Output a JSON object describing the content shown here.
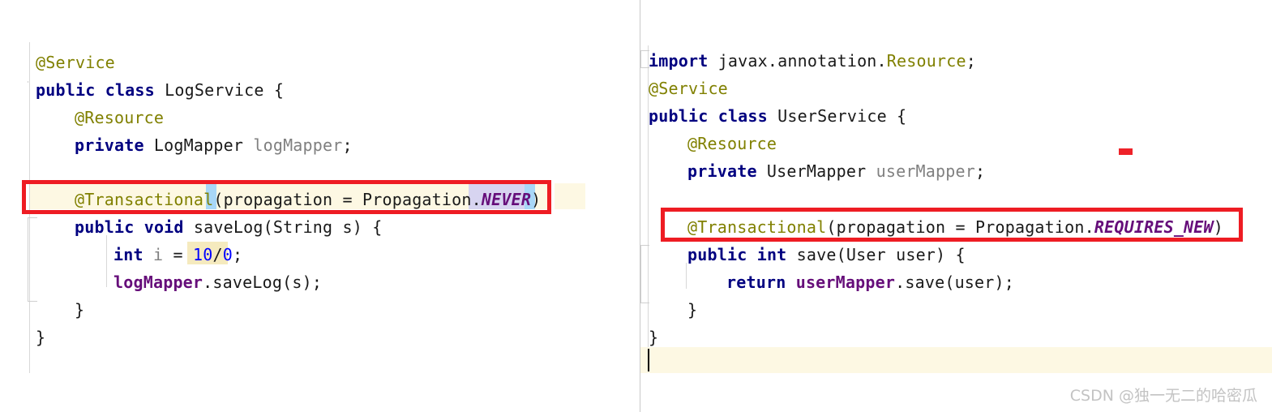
{
  "editor": {
    "theme": "IntelliJ Light",
    "split_panes": 2,
    "colors": {
      "keyword": "#000080",
      "annotation": "#808000",
      "field": "#660e7a",
      "local_var": "#808080",
      "number": "#0000ff",
      "enum_constant": "#660e7a",
      "plain_text": "#1a1a1a",
      "caret_row_bg": "#fdf8e3",
      "error_highlight_bg": "#f5eabe",
      "brace_match_bg": "#a8d7f7",
      "selection_bg": "#d7d4f0",
      "annotation_box": "#ee1c23",
      "error_stripe": "#ee2229",
      "splitter": "#c9c9c9",
      "indent_guide": "#d8d8d8"
    }
  },
  "left_pane": {
    "file_class": "LogService",
    "lines": [
      {
        "indent": 0,
        "tokens": [
          {
            "t": "@Service",
            "c": "ann"
          }
        ]
      },
      {
        "indent": 0,
        "tokens": [
          {
            "t": "public",
            "c": "kw"
          },
          {
            "t": " ",
            "c": "plain"
          },
          {
            "t": "class",
            "c": "kw"
          },
          {
            "t": " LogService {",
            "c": "plain"
          }
        ]
      },
      {
        "indent": 1,
        "tokens": [
          {
            "t": "@Resource",
            "c": "ann"
          }
        ]
      },
      {
        "indent": 1,
        "tokens": [
          {
            "t": "private",
            "c": "kw"
          },
          {
            "t": " LogMapper ",
            "c": "plain"
          },
          {
            "t": "logMapper",
            "c": "var"
          },
          {
            "t": ";",
            "c": "plain"
          }
        ]
      },
      {
        "indent": 1,
        "tokens": []
      },
      {
        "indent": 1,
        "tokens": [
          {
            "t": "@Transactional",
            "c": "ann"
          },
          {
            "t": "(propagation = Propagation.",
            "c": "plain"
          },
          {
            "t": "NEVER",
            "c": "enumc"
          },
          {
            "t": ")",
            "c": "plain"
          }
        ]
      },
      {
        "indent": 1,
        "tokens": [
          {
            "t": "public",
            "c": "kw"
          },
          {
            "t": " ",
            "c": "plain"
          },
          {
            "t": "void",
            "c": "kw"
          },
          {
            "t": " saveLog(String s) {",
            "c": "plain"
          }
        ]
      },
      {
        "indent": 2,
        "tokens": [
          {
            "t": "int",
            "c": "kw"
          },
          {
            "t": " ",
            "c": "plain"
          },
          {
            "t": "i",
            "c": "var"
          },
          {
            "t": " = ",
            "c": "plain"
          },
          {
            "t": "10",
            "c": "num"
          },
          {
            "t": "/",
            "c": "plain"
          },
          {
            "t": "0",
            "c": "num"
          },
          {
            "t": ";",
            "c": "plain"
          }
        ]
      },
      {
        "indent": 2,
        "tokens": [
          {
            "t": "logMapper",
            "c": "fld"
          },
          {
            "t": ".saveLog(s);",
            "c": "plain"
          }
        ]
      },
      {
        "indent": 1,
        "tokens": [
          {
            "t": "}",
            "c": "plain"
          }
        ]
      },
      {
        "indent": 0,
        "tokens": [
          {
            "t": "}",
            "c": "plain"
          }
        ]
      }
    ],
    "raw_text": [
      "@Service",
      "public class LogService {",
      "    @Resource",
      "    private LogMapper logMapper;",
      "",
      "    @Transactional(propagation = Propagation.NEVER)",
      "    public void saveLog(String s) {",
      "        int i = 10/0;",
      "        logMapper.saveLog(s);",
      "    }",
      "}"
    ],
    "highlighted_line": "@Transactional(propagation = Propagation.NEVER)",
    "error_highlight_text": "10/0",
    "brace_match_chars": "( )",
    "selected_text": "NEVER"
  },
  "right_pane": {
    "file_class": "UserService",
    "lines": [
      {
        "indent": 0,
        "tokens": [
          {
            "t": "import",
            "c": "kw"
          },
          {
            "t": " javax.annotation.",
            "c": "plain"
          },
          {
            "t": "Resource",
            "c": "ann"
          },
          {
            "t": ";",
            "c": "plain"
          }
        ]
      },
      {
        "indent": 0,
        "tokens": [
          {
            "t": "@Service",
            "c": "ann"
          }
        ]
      },
      {
        "indent": 0,
        "tokens": [
          {
            "t": "public",
            "c": "kw"
          },
          {
            "t": " ",
            "c": "plain"
          },
          {
            "t": "class",
            "c": "kw"
          },
          {
            "t": " UserService {",
            "c": "plain"
          }
        ]
      },
      {
        "indent": 1,
        "tokens": [
          {
            "t": "@Resource",
            "c": "ann"
          }
        ]
      },
      {
        "indent": 1,
        "tokens": [
          {
            "t": "private",
            "c": "kw"
          },
          {
            "t": " UserMapper ",
            "c": "plain"
          },
          {
            "t": "userMapper",
            "c": "var"
          },
          {
            "t": ";",
            "c": "plain"
          }
        ]
      },
      {
        "indent": 1,
        "tokens": []
      },
      {
        "indent": 1,
        "tokens": [
          {
            "t": "@Transactional",
            "c": "ann"
          },
          {
            "t": "(propagation = Propagation.",
            "c": "plain"
          },
          {
            "t": "REQUIRES_NEW",
            "c": "enumc"
          },
          {
            "t": ")",
            "c": "plain"
          }
        ]
      },
      {
        "indent": 1,
        "tokens": [
          {
            "t": "public",
            "c": "kw"
          },
          {
            "t": " ",
            "c": "plain"
          },
          {
            "t": "int",
            "c": "kw"
          },
          {
            "t": " save(User user) {",
            "c": "plain"
          }
        ]
      },
      {
        "indent": 2,
        "tokens": [
          {
            "t": "return",
            "c": "kw"
          },
          {
            "t": " ",
            "c": "plain"
          },
          {
            "t": "userMapper",
            "c": "fld"
          },
          {
            "t": ".save(user);",
            "c": "plain"
          }
        ]
      },
      {
        "indent": 1,
        "tokens": [
          {
            "t": "}",
            "c": "plain"
          }
        ]
      },
      {
        "indent": 0,
        "tokens": [
          {
            "t": "}",
            "c": "plain"
          }
        ]
      },
      {
        "indent": 0,
        "tokens": []
      }
    ],
    "raw_text": [
      "import javax.annotation.Resource;",
      "@Service",
      "public class UserService {",
      "    @Resource",
      "    private UserMapper userMapper;",
      "",
      "    @Transactional(propagation = Propagation.REQUIRES_NEW)",
      "    public int save(User user) {",
      "        return userMapper.save(user);",
      "    }",
      "}",
      ""
    ],
    "highlighted_line": "@Transactional(propagation = Propagation.REQUIRES_NEW)",
    "caret_on_line": 12,
    "error_stripe_present": true
  },
  "watermark": {
    "text": "CSDN @独一无二的哈密瓜"
  }
}
